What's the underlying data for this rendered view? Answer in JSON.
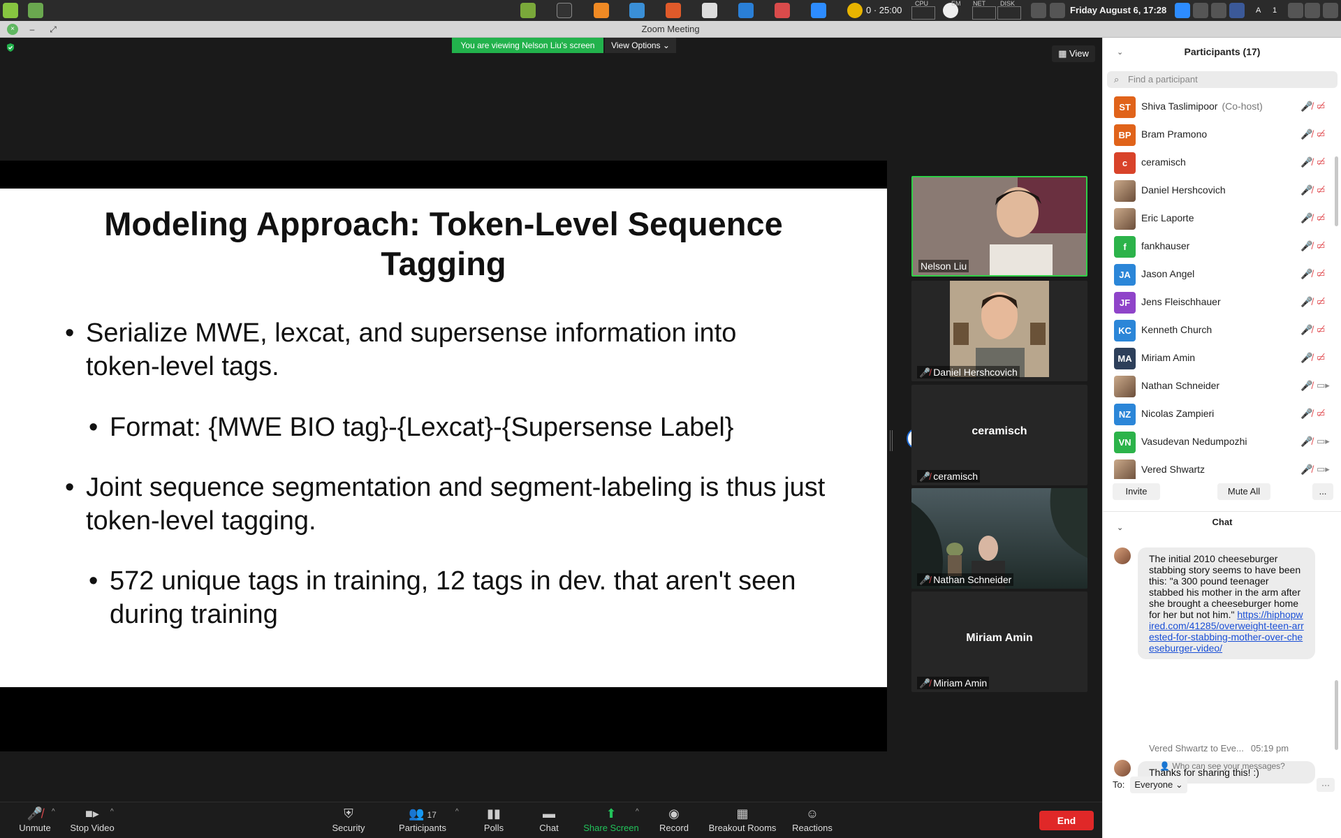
{
  "system_bar": {
    "timer": "0 · 25:00",
    "cpu_label": "CPU",
    "mem_label": "EM",
    "net_label": "NET",
    "disk_label": "DISK",
    "datetime": "Friday August  6, 17:28",
    "keyboard_indicator": "A",
    "workspace_indicator": "1"
  },
  "window": {
    "title": "Zoom Meeting"
  },
  "meeting": {
    "banner": "You are viewing Nelson Liu's screen",
    "view_options": "View Options ⌄",
    "view_button": "View"
  },
  "slide": {
    "title": "Modeling Approach: Token-Level Sequence Tagging",
    "bullets": [
      "Serialize MWE, lexcat, and supersense information into token-level tags.",
      "Format: {MWE BIO tag}-{Lexcat}-{Supersense Label}",
      "Joint sequence segmentation and segment-labeling is thus just token-level tagging.",
      "572 unique tags in training, 12 tags in dev. that aren't seen during training"
    ]
  },
  "gallery": {
    "tiles": [
      {
        "name": "Nelson Liu"
      },
      {
        "name": "Daniel Hershcovich"
      },
      {
        "name": "ceramisch",
        "center": "ceramisch"
      },
      {
        "name": "Nathan Schneider"
      },
      {
        "name": "Miriam Amin",
        "center": "Miriam Amin"
      }
    ]
  },
  "controls": {
    "unmute": "Unmute",
    "stop_video": "Stop Video",
    "security": "Security",
    "participants": "Participants",
    "participants_count": "17",
    "polls": "Polls",
    "chat": "Chat",
    "share_screen": "Share Screen",
    "record": "Record",
    "breakout_rooms": "Breakout Rooms",
    "reactions": "Reactions",
    "end": "End"
  },
  "participants_panel": {
    "title": "Participants (17)",
    "search_placeholder": "Find a participant",
    "list": [
      {
        "initials": "ST",
        "name": "Shiva Taslimipoor",
        "role": "(Co-host)",
        "color": "#e0631a",
        "video_on": false
      },
      {
        "initials": "BP",
        "name": "Bram Pramono",
        "role": "",
        "color": "#e0631a",
        "video_on": false
      },
      {
        "initials": "c",
        "name": "ceramisch",
        "role": "",
        "color": "#d8432a",
        "video_on": false
      },
      {
        "initials": "",
        "name": "Daniel Hershcovich",
        "role": "",
        "color": "",
        "video_on": false
      },
      {
        "initials": "",
        "name": "Eric Laporte",
        "role": "",
        "color": "",
        "video_on": false
      },
      {
        "initials": "f",
        "name": "fankhauser",
        "role": "",
        "color": "#2cb34a",
        "video_on": false
      },
      {
        "initials": "JA",
        "name": "Jason Angel",
        "role": "",
        "color": "#2b86d8",
        "video_on": false
      },
      {
        "initials": "JF",
        "name": "Jens Fleischhauer",
        "role": "",
        "color": "#8f44c9",
        "video_on": false
      },
      {
        "initials": "KC",
        "name": "Kenneth Church",
        "role": "",
        "color": "#2b86d8",
        "video_on": false
      },
      {
        "initials": "MA",
        "name": "Miriam Amin",
        "role": "",
        "color": "#2d3f5a",
        "video_on": false
      },
      {
        "initials": "",
        "name": "Nathan Schneider",
        "role": "",
        "color": "",
        "video_on": true
      },
      {
        "initials": "NZ",
        "name": "Nicolas Zampieri",
        "role": "",
        "color": "#2b86d8",
        "video_on": false
      },
      {
        "initials": "VN",
        "name": "Vasudevan Nedumpozhi",
        "role": "",
        "color": "#2cb34a",
        "video_on": true
      },
      {
        "initials": "",
        "name": "Vered Shwartz",
        "role": "",
        "color": "",
        "video_on": true
      }
    ],
    "invite": "Invite",
    "mute_all": "Mute All",
    "more": "..."
  },
  "chat_panel": {
    "title": "Chat",
    "message1_text": "The initial 2010 cheeseburger stabbing story seems to have been this: \"a 300 pound teenager stabbed his mother in the arm after she brought a cheeseburger home for her but not him.\" ",
    "message1_link": "https://hiphopwired.com/41285/overweight-teen-arrested-for-stabbing-mother-over-cheeseburger-video/",
    "message2_sender": "Vered Shwartz to Eve...",
    "message2_time": "05:19 pm",
    "message2_text": "Thanks for sharing this! :)",
    "who_can_see": "Who can see your messages?",
    "to_label": "To:",
    "to_value": "Everyone ⌄",
    "more": "···"
  },
  "colors": {
    "accent_green": "#22b24c",
    "end_red": "#e02828",
    "muted_red": "#e0484d",
    "link_blue": "#1a4fd6"
  }
}
